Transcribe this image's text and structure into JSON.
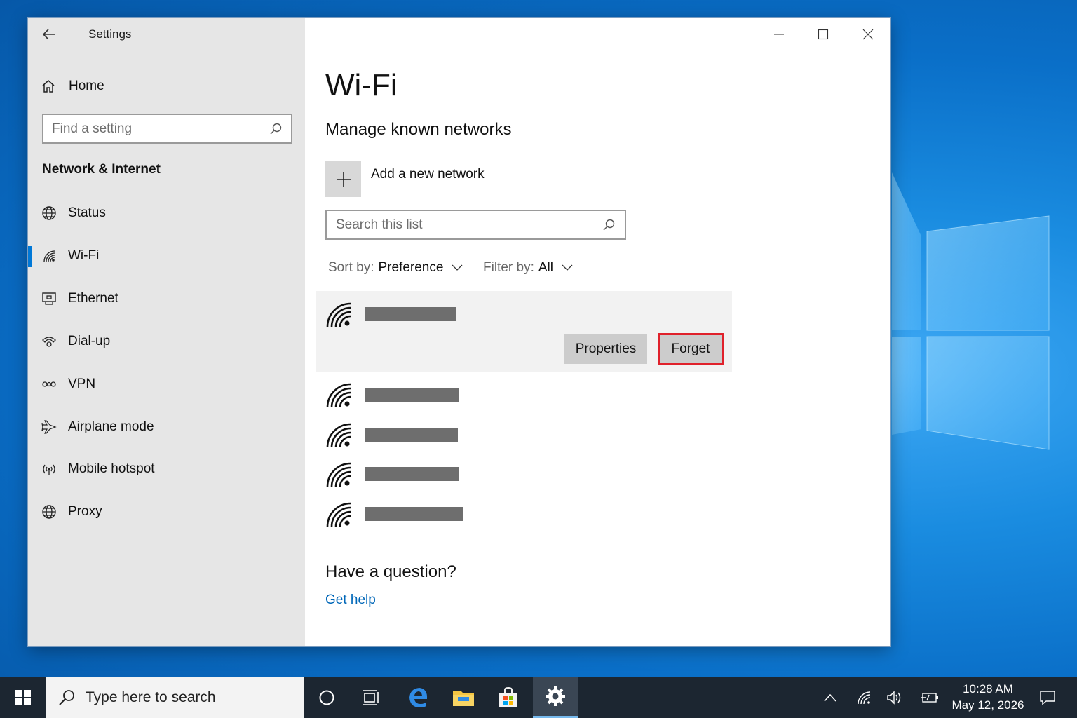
{
  "window": {
    "title": "Settings",
    "controls": {
      "minimize": "minimize-icon",
      "maximize": "maximize-icon",
      "close": "close-icon"
    }
  },
  "sidebar": {
    "home_label": "Home",
    "search_placeholder": "Find a setting",
    "section_header": "Network & Internet",
    "items": [
      {
        "label": "Status",
        "icon": "globe-status-icon"
      },
      {
        "label": "Wi-Fi",
        "icon": "wifi-icon",
        "active": true
      },
      {
        "label": "Ethernet",
        "icon": "ethernet-icon"
      },
      {
        "label": "Dial-up",
        "icon": "dialup-icon"
      },
      {
        "label": "VPN",
        "icon": "vpn-icon"
      },
      {
        "label": "Airplane mode",
        "icon": "airplane-icon"
      },
      {
        "label": "Mobile hotspot",
        "icon": "hotspot-icon"
      },
      {
        "label": "Proxy",
        "icon": "globe-icon"
      }
    ]
  },
  "main": {
    "title": "Wi-Fi",
    "subtitle": "Manage known networks",
    "add_network_label": "Add a new network",
    "list_search_placeholder": "Search this list",
    "sort": {
      "key": "Sort by:",
      "value": "Preference"
    },
    "filter": {
      "key": "Filter by:",
      "value": "All"
    },
    "networks": [
      {
        "name": "",
        "redacted": true,
        "selected": true
      },
      {
        "name": "",
        "redacted": true
      },
      {
        "name": "",
        "redacted": true
      },
      {
        "name": "",
        "redacted": true
      },
      {
        "name": "",
        "redacted": true
      }
    ],
    "properties_label": "Properties",
    "forget_label": "Forget",
    "question_label": "Have a question?",
    "help_link": "Get help"
  },
  "taskbar": {
    "search_placeholder": "Type here to search",
    "time": "10:28 AM",
    "date": "May 12, 2026",
    "accent_color": "#76b9ed"
  },
  "colors": {
    "highlight_border": "#e0212b",
    "link": "#0067b8",
    "active_indicator": "#0078d7"
  }
}
